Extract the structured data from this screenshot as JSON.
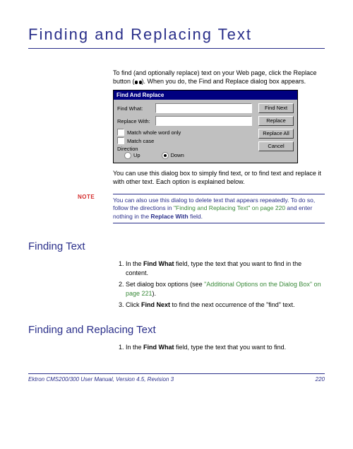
{
  "title": "Finding and Replacing Text",
  "intro": {
    "line1_pre": "To find (and optionally replace) text on your Web page, click",
    "line2_pre": "the Replace button (",
    "line2_post": "). When you do, the Find and Replace dialog box appears."
  },
  "dialog": {
    "title": "Find And Replace",
    "find_what_label": "Find What:",
    "replace_with_label": "Replace With:",
    "match_whole_word": "Match whole word only",
    "match_case": "Match case",
    "direction_label": "Direction",
    "up_label": "Up",
    "down_label": "Down",
    "btn_find_next": "Find Next",
    "btn_replace": "Replace",
    "btn_replace_all": "Replace All",
    "btn_cancel": "Cancel"
  },
  "after_dialog": "You can use this dialog box to simply find text, or to find text and replace it with other text. Each option is explained below.",
  "note": {
    "label": "NOTE",
    "text_pre": "You can also use this dialog to delete text that appears repeatedly. To do so, follow the directions in ",
    "link": "\"Finding and Replacing Text\" on page 220",
    "text_mid": " and enter nothing in the ",
    "bold": "Replace With",
    "text_post": " field."
  },
  "section_finding": {
    "heading": "Finding Text",
    "steps": [
      {
        "pre": "In the ",
        "bold": "Find What",
        "post": " field, type the text that you want to find in the content."
      },
      {
        "pre": "Set dialog box options (see ",
        "link": "\"Additional Options on the Dialog Box\" on page 221",
        "post": ")."
      },
      {
        "pre": "Click ",
        "bold": "Find Next",
        "post": " to find the next occurrence of the \"find\" text."
      }
    ]
  },
  "section_replacing": {
    "heading": "Finding and Replacing Text",
    "steps": [
      {
        "pre": "In the ",
        "bold": "Find What",
        "post": " field, type the text that you want to find."
      }
    ]
  },
  "footer": {
    "text": "Ektron CMS200/300 User Manual, Version 4.5, Revision 3",
    "page": "220"
  }
}
